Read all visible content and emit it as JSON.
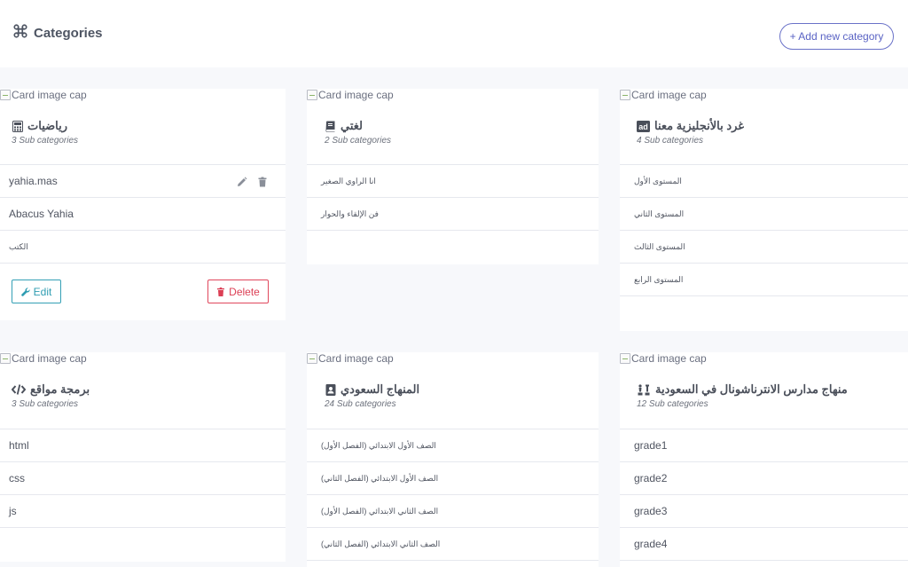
{
  "header": {
    "title": "Categories",
    "add_button": "+ Add new category"
  },
  "image_alt": "Card image cap",
  "cards": [
    {
      "name": "رياضيات",
      "icon": "calculator-icon",
      "sub_count": "3 Sub categories",
      "items": [
        "yahia.mas",
        "Abacus Yahia",
        "الكتب"
      ],
      "edit_label": "Edit",
      "delete_label": "Delete"
    },
    {
      "name": "لغتي",
      "icon": "book-icon",
      "sub_count": "2 Sub categories",
      "items": [
        "انا الراوي الصغير",
        "فن الإلقاء والحوار"
      ]
    },
    {
      "name": "غرد بالأنجليزية معنا",
      "icon": "ad-icon",
      "sub_count": "4 Sub categories",
      "items": [
        "المستوى الأول",
        "المستوى الثاني",
        "المستوى الثالث",
        "المستوى الرابع"
      ]
    },
    {
      "name": "برمجة مواقع",
      "icon": "code-icon",
      "sub_count": "3 Sub categories",
      "items": [
        "html",
        "css",
        "js"
      ]
    },
    {
      "name": "المنهاج السعودي",
      "icon": "address-book-icon",
      "sub_count": "24 Sub categories",
      "items": [
        "الصف الأول الابتدائي (الفصل الأول)",
        "الصف الأول الابتدائي (الفصل الثاني)",
        "الصف الثاني الابتدائي (الفصل الأول)",
        "الصف الثاني الابتدائي (الفصل الثاني)"
      ]
    },
    {
      "name": "منهاج مدارس الانترناشونال في السعودية",
      "icon": "chess-icon",
      "sub_count": "12 Sub categories",
      "items": [
        "grade1",
        "grade2",
        "grade3",
        "grade4"
      ]
    }
  ]
}
